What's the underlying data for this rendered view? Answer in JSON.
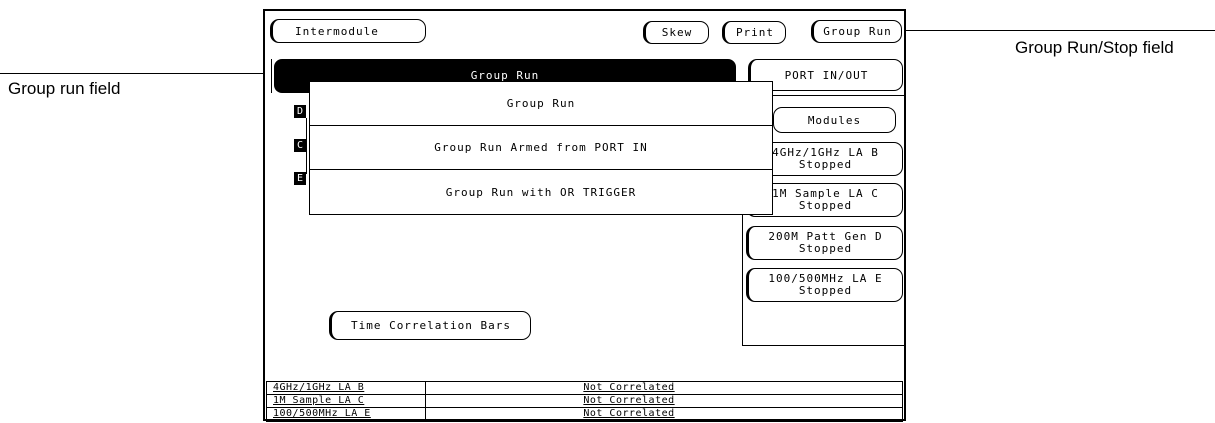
{
  "callouts": {
    "group_run_stop_field": "Group Run/Stop field",
    "group_run_field": "Group run field"
  },
  "header": {
    "intermodule": "Intermodule",
    "skew": "Skew",
    "print": "Print",
    "group_run": "Group Run"
  },
  "group_run_field": {
    "label": "Group Run"
  },
  "popup": {
    "items": [
      "Group Run",
      "Group Run Armed from PORT IN",
      "Group Run with OR TRIGGER"
    ]
  },
  "tree_tags": [
    "D",
    "C",
    "E"
  ],
  "side": {
    "port_in_out": "PORT IN/OUT",
    "modules": "Modules",
    "module_buttons": [
      {
        "name": "4GHz/1GHz LA B",
        "status": "Stopped"
      },
      {
        "name": "1M Sample LA C",
        "status": "Stopped"
      },
      {
        "name": "200M Patt Gen D",
        "status": "Stopped"
      },
      {
        "name": "100/500MHz LA E",
        "status": "Stopped"
      }
    ]
  },
  "time_correlation_bars": "Time Correlation Bars",
  "correlation_table": {
    "rows": [
      {
        "module": "4GHz/1GHz LA B",
        "status": "Not Correlated"
      },
      {
        "module": "1M Sample LA C",
        "status": "Not Correlated"
      },
      {
        "module": "100/500MHz LA E",
        "status": "Not Correlated"
      }
    ]
  }
}
